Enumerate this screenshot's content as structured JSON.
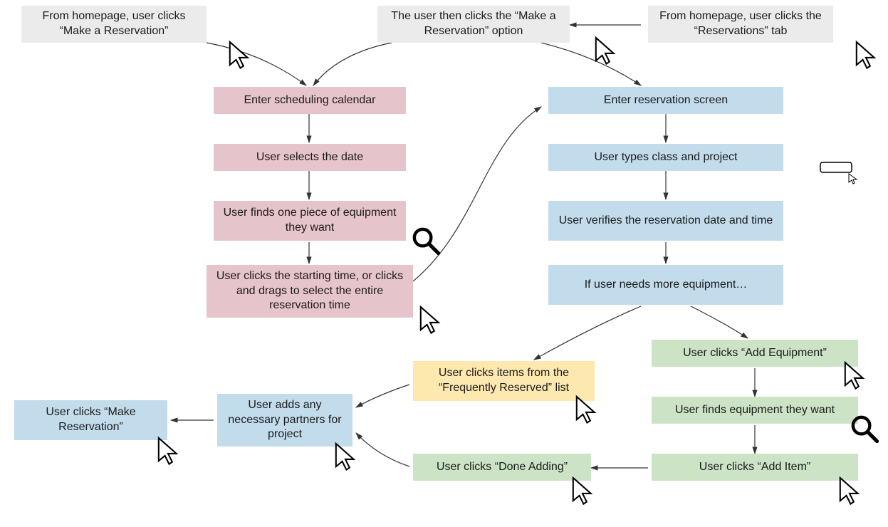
{
  "nodes": {
    "g1": "From homepage, user clicks “Make a Reservation”",
    "g2": "The user then clicks the “Make a Reservation” option",
    "g3": "From homepage, user clicks the “Reservations” tab",
    "p1": "Enter scheduling calendar",
    "p2": "User selects the date",
    "p3": "User finds one piece of equipment they want",
    "p4": "User clicks the starting time, or clicks and drags to select the entire reservation time",
    "b1": "Enter reservation screen",
    "b2": "User types class and project",
    "b3": "User verifies the reservation date and time",
    "b4": "If user needs more equipment…",
    "y1": "User clicks items from the “Frequently Reserved” list",
    "e1": "User clicks “Add Equipment”",
    "e2": "User finds equipment they want",
    "e3": "User clicks “Add Item”",
    "e4": "User clicks “Done Adding”",
    "b5": "User adds any necessary partners for project",
    "b6": "User clicks “Make Reservation”"
  },
  "colors": {
    "gray": "#ebebeb",
    "pink": "#e6c4cb",
    "blue": "#c3dcec",
    "yellow": "#fde8b0",
    "green": "#cce4c5"
  }
}
